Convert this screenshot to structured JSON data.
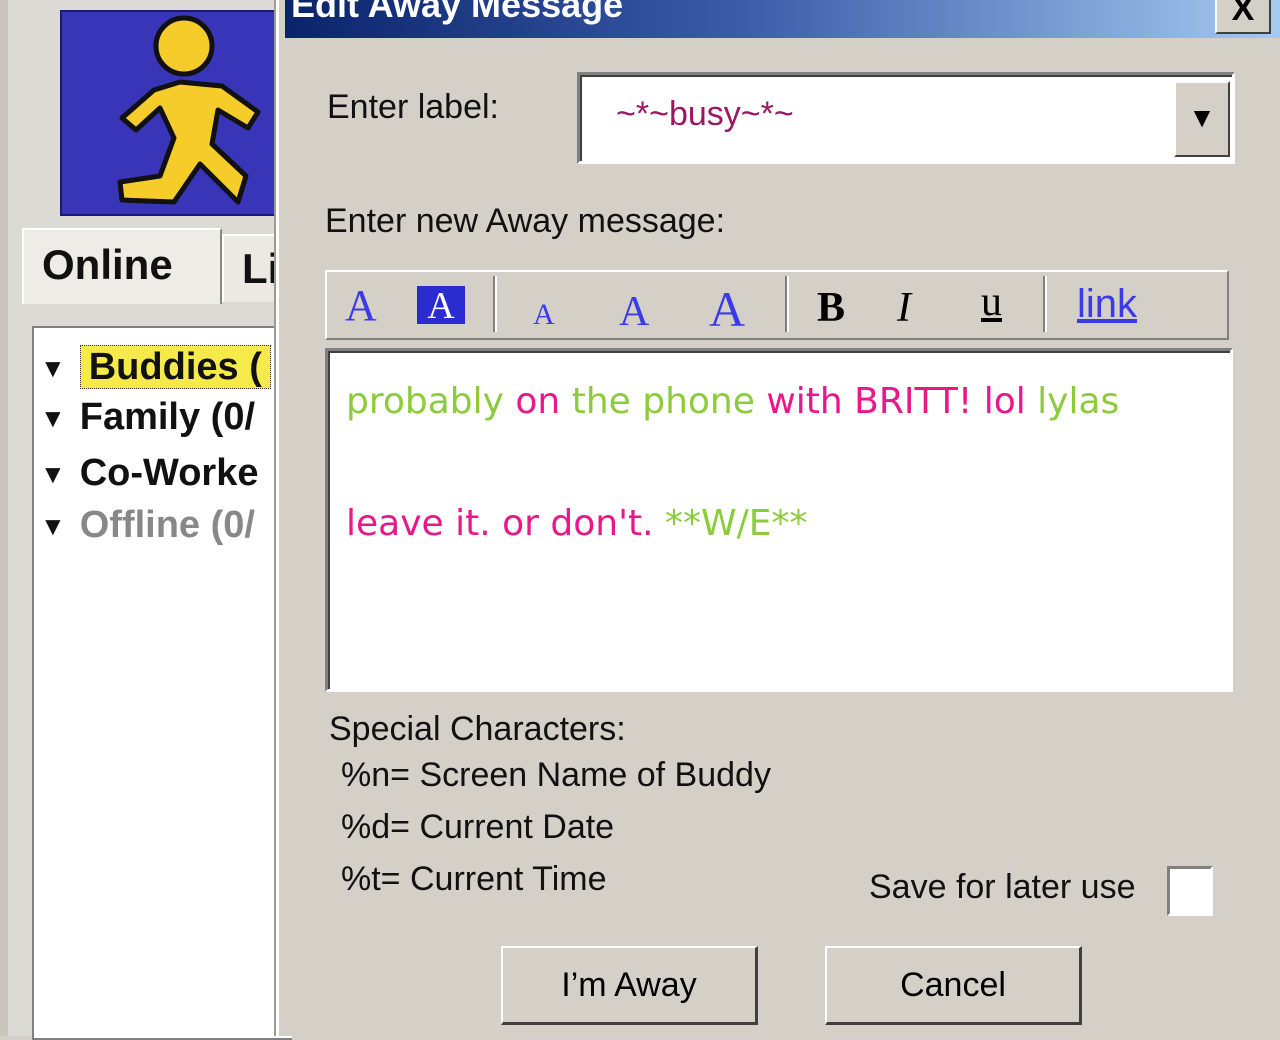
{
  "buddy_window": {
    "tabs": [
      {
        "label": "Online"
      },
      {
        "label": "Lib"
      }
    ],
    "groups": [
      {
        "name": "Buddies",
        "suffix": " ("
      },
      {
        "name": "Family (0/"
      },
      {
        "name": "Co-Worke"
      },
      {
        "name": "Offline (0/"
      }
    ]
  },
  "dialog": {
    "title": "Edit Away Message",
    "close_label": "X",
    "enter_label_text": "Enter label:",
    "label_value": "~*~busy~*~",
    "dropdown_glyph": "▼",
    "enter_message_text": "Enter new Away message:",
    "toolbar": {
      "text_color": "A",
      "back_color": "A",
      "small_font": "A",
      "normal_font": "A",
      "large_font": "A",
      "bold": "B",
      "italic": "I",
      "underline": "u",
      "link": "link"
    },
    "message": {
      "line1": [
        {
          "text": "probably ",
          "color": "green"
        },
        {
          "text": "on ",
          "color": "pink"
        },
        {
          "text": "the phone ",
          "color": "green"
        },
        {
          "text": "with BRITT! lol ",
          "color": "pink"
        },
        {
          "text": "lylas",
          "color": "green"
        }
      ],
      "line2": [
        {
          "text": "leave it. or don't. ",
          "color": "pink"
        },
        {
          "text": "**W/E**",
          "color": "green"
        }
      ]
    },
    "special": {
      "title": "Special Characters:",
      "items": [
        "%n= Screen Name of Buddy",
        "%d= Current Date",
        "%t= Current Time"
      ]
    },
    "save_label": "Save for later use",
    "save_checked": false,
    "buttons": {
      "away": "I’m Away",
      "cancel": "Cancel"
    }
  },
  "colors": {
    "title_bar_start": "#0a246a",
    "title_bar_end": "#a6caf0",
    "label_value": "#9a1863",
    "message_green": "#8ccc3a",
    "message_pink": "#e8178a",
    "buddies_highlight": "#f6e94a",
    "logo_background": "#3835b8",
    "logo_figure": "#f5cc2a"
  },
  "icons": {
    "logo": "aim-running-man-icon",
    "group_expand": "triangle-down-icon",
    "dropdown": "chevron-down-icon"
  }
}
